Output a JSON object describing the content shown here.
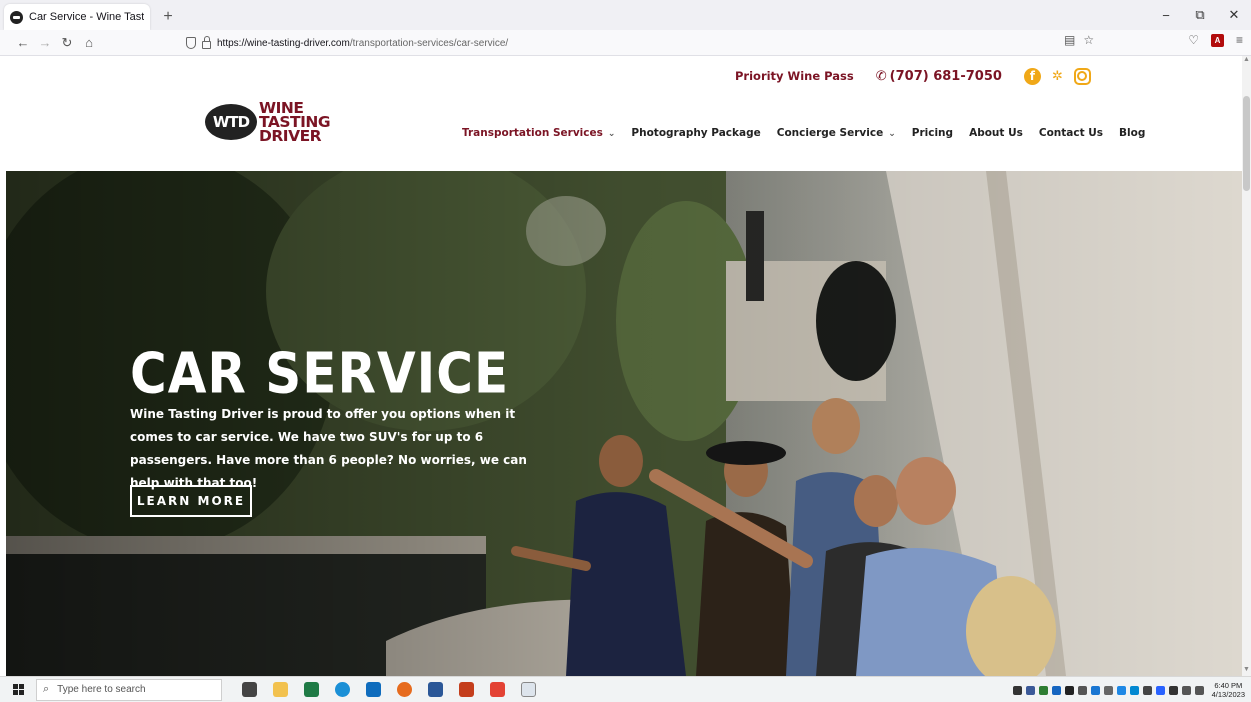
{
  "browser": {
    "tab_title": "Car Service - Wine Tasting DriverX",
    "new_tab": "+",
    "url_domain": "https://wine-tasting-driver.com",
    "url_path": "/transportation-services/car-service/",
    "win_min": "−",
    "win_restore": "⧉",
    "win_close": "✕"
  },
  "topbar": {
    "priority_pass": "Priority Wine Pass",
    "phone": "(707) 681-7050"
  },
  "logo": {
    "badge": "WTD",
    "line1": "WINE",
    "line2": "TASTING",
    "line3": "DRIVER"
  },
  "nav": {
    "items": [
      {
        "label": "Transportation Services",
        "dropdown": true
      },
      {
        "label": "Photography Package",
        "dropdown": false
      },
      {
        "label": "Concierge Service",
        "dropdown": true
      },
      {
        "label": "Pricing",
        "dropdown": false
      },
      {
        "label": "About Us",
        "dropdown": false
      },
      {
        "label": "Contact Us",
        "dropdown": false
      },
      {
        "label": "Blog",
        "dropdown": false
      }
    ]
  },
  "hero": {
    "title": "CAR SERVICE",
    "description": "Wine Tasting Driver is proud to offer you options when it comes to car service. We have two SUV's for up to 6 passengers. Have more than 6 people? No worries, we can help with that too!",
    "button": "LEARN MORE"
  },
  "taskbar": {
    "search_placeholder": "Type here to search",
    "time": "6:40 PM",
    "date": "4/13/2023"
  },
  "colors": {
    "brand": "#7b1424",
    "accent": "#f0a818"
  }
}
